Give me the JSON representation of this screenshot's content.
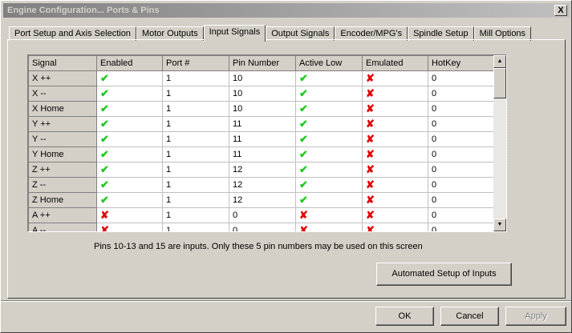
{
  "window": {
    "title": "Engine Configuration... Ports & Pins",
    "close": "X"
  },
  "tabs": [
    "Port Setup and Axis Selection",
    "Motor Outputs",
    "Input Signals",
    "Output Signals",
    "Encoder/MPG's",
    "Spindle Setup",
    "Mill Options"
  ],
  "active_tab": 2,
  "grid": {
    "columns": [
      "Signal",
      "Enabled",
      "Port #",
      "Pin Number",
      "Active Low",
      "Emulated",
      "HotKey"
    ],
    "rows": [
      {
        "signal": "X ++",
        "enabled": true,
        "port": "1",
        "pin": "10",
        "active_low": true,
        "emulated": false,
        "hotkey": "0"
      },
      {
        "signal": "X --",
        "enabled": true,
        "port": "1",
        "pin": "10",
        "active_low": true,
        "emulated": false,
        "hotkey": "0"
      },
      {
        "signal": "X Home",
        "enabled": true,
        "port": "1",
        "pin": "10",
        "active_low": true,
        "emulated": false,
        "hotkey": "0"
      },
      {
        "signal": "Y ++",
        "enabled": true,
        "port": "1",
        "pin": "11",
        "active_low": true,
        "emulated": false,
        "hotkey": "0"
      },
      {
        "signal": "Y --",
        "enabled": true,
        "port": "1",
        "pin": "11",
        "active_low": true,
        "emulated": false,
        "hotkey": "0"
      },
      {
        "signal": "Y Home",
        "enabled": true,
        "port": "1",
        "pin": "11",
        "active_low": true,
        "emulated": false,
        "hotkey": "0"
      },
      {
        "signal": "Z ++",
        "enabled": true,
        "port": "1",
        "pin": "12",
        "active_low": true,
        "emulated": false,
        "hotkey": "0"
      },
      {
        "signal": "Z --",
        "enabled": true,
        "port": "1",
        "pin": "12",
        "active_low": true,
        "emulated": false,
        "hotkey": "0"
      },
      {
        "signal": "Z Home",
        "enabled": true,
        "port": "1",
        "pin": "12",
        "active_low": true,
        "emulated": false,
        "hotkey": "0"
      },
      {
        "signal": "A ++",
        "enabled": false,
        "port": "1",
        "pin": "0",
        "active_low": false,
        "emulated": false,
        "hotkey": "0"
      },
      {
        "signal": "A --",
        "enabled": false,
        "port": "1",
        "pin": "0",
        "active_low": false,
        "emulated": false,
        "hotkey": "0"
      }
    ]
  },
  "icons": {
    "check": "✔",
    "cross": "✘"
  },
  "note": "Pins 10-13 and 15 are inputs. Only these 5 pin numbers may be used on this screen",
  "buttons": {
    "auto": "Automated Setup of Inputs",
    "ok": "OK",
    "cancel": "Cancel",
    "apply": "Apply"
  }
}
